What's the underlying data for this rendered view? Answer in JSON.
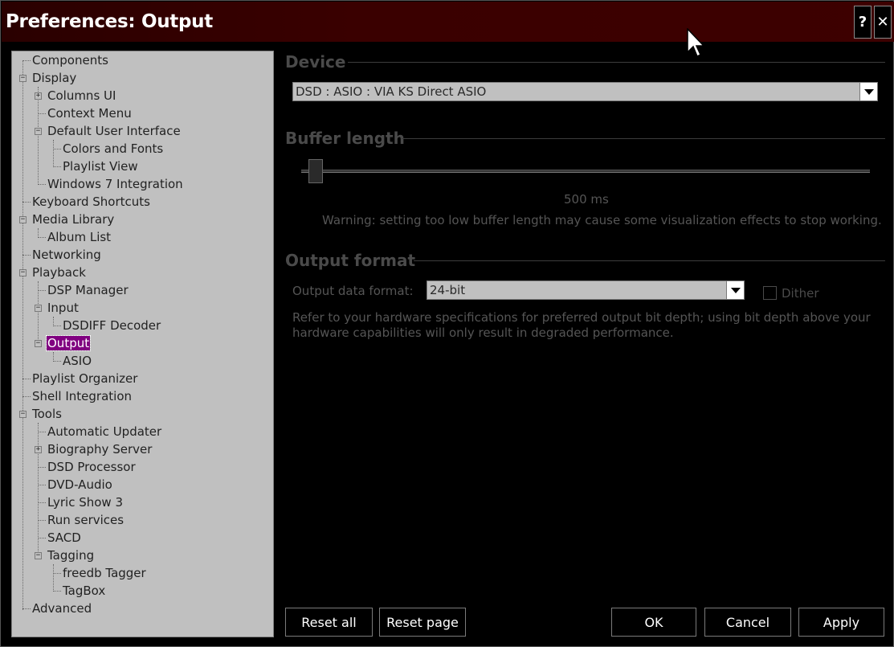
{
  "window": {
    "title": "Preferences: Output",
    "help_label": "?",
    "close_label": "✕"
  },
  "tree": {
    "items": [
      {
        "label": "Components"
      },
      {
        "label": "Display"
      },
      {
        "label": "Columns UI"
      },
      {
        "label": "Context Menu"
      },
      {
        "label": "Default User Interface"
      },
      {
        "label": "Colors and Fonts"
      },
      {
        "label": "Playlist View"
      },
      {
        "label": "Windows 7 Integration"
      },
      {
        "label": "Keyboard Shortcuts"
      },
      {
        "label": "Media Library"
      },
      {
        "label": "Album List"
      },
      {
        "label": "Networking"
      },
      {
        "label": "Playback"
      },
      {
        "label": "DSP Manager"
      },
      {
        "label": "Input"
      },
      {
        "label": "DSDIFF Decoder"
      },
      {
        "label": "Output"
      },
      {
        "label": "ASIO"
      },
      {
        "label": "Playlist Organizer"
      },
      {
        "label": "Shell Integration"
      },
      {
        "label": "Tools"
      },
      {
        "label": "Automatic Updater"
      },
      {
        "label": "Biography Server"
      },
      {
        "label": "DSD Processor"
      },
      {
        "label": "DVD-Audio"
      },
      {
        "label": "Lyric Show 3"
      },
      {
        "label": "Run services"
      },
      {
        "label": "SACD"
      },
      {
        "label": "Tagging"
      },
      {
        "label": "freedb Tagger"
      },
      {
        "label": "TagBox"
      },
      {
        "label": "Advanced"
      }
    ]
  },
  "device": {
    "section_title": "Device",
    "selected": "DSD : ASIO : VIA KS Direct ASIO"
  },
  "buffer": {
    "section_title": "Buffer length",
    "value_label": "500 ms",
    "warning": "Warning: setting too low buffer length may cause some visualization effects to stop working."
  },
  "output_format": {
    "section_title": "Output format",
    "data_format_label": "Output data format:",
    "data_format_value": "24-bit",
    "dither_label": "Dither",
    "note_line1": "Refer to your hardware specifications for preferred output bit depth; using bit depth above your",
    "note_line2": "hardware capabilities will only result in degraded performance."
  },
  "buttons": {
    "reset_all": "Reset all",
    "reset_page": "Reset page",
    "ok": "OK",
    "cancel": "Cancel",
    "apply": "Apply"
  }
}
